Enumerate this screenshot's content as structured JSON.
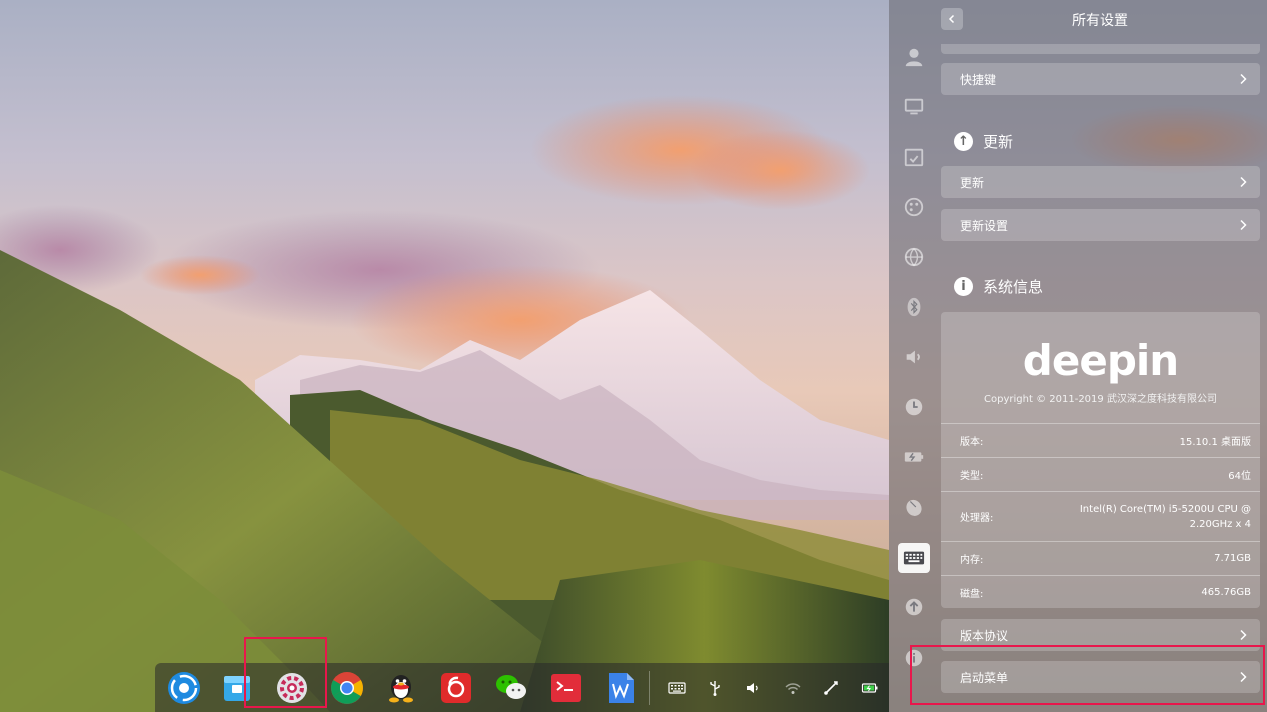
{
  "settings": {
    "title": "所有设置",
    "shortcuts_label": "快捷键",
    "update_section": "更新",
    "update_label": "更新",
    "update_settings_label": "更新设置",
    "sysinfo_section": "系统信息",
    "brand": "deepin",
    "copyright": "Copyright © 2011-2019 武汉深之度科技有限公司",
    "specs": [
      {
        "key": "版本:",
        "value": "15.10.1 桌面版"
      },
      {
        "key": "类型:",
        "value": "64位"
      },
      {
        "key": "处理器:",
        "value": "Intel(R) Core(TM) i5-5200U CPU @ 2.20GHz x 4"
      },
      {
        "key": "内存:",
        "value": "7.71GB"
      },
      {
        "key": "磁盘:",
        "value": "465.76GB"
      }
    ],
    "license_label": "版本协议",
    "boot_menu_label": "启动菜单",
    "side_icons": [
      "user-icon",
      "display-icon",
      "calendar-icon",
      "personalization-icon",
      "network-icon",
      "bluetooth-icon",
      "sound-icon",
      "time-icon",
      "power-icon",
      "mouse-icon",
      "keyboard-icon",
      "update-icon",
      "info-icon"
    ]
  },
  "dock": {
    "apps": [
      "launcher",
      "file-manager",
      "control-center",
      "chrome",
      "qq",
      "netease-music",
      "wechat",
      "terminal",
      "wps"
    ],
    "tray": [
      "keyboard-layout",
      "usb",
      "volume",
      "wifi",
      "screen-tool",
      "battery"
    ]
  },
  "colors": {
    "highlight": "#e8174c"
  }
}
